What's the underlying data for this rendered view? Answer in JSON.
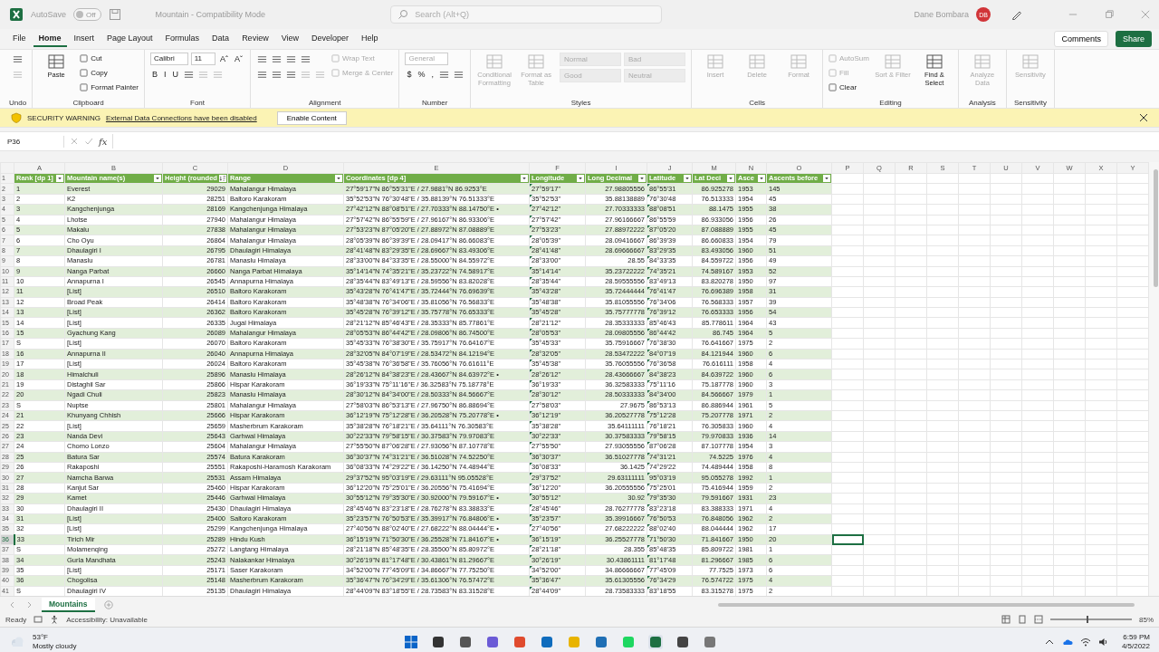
{
  "title_bar": {
    "autosave_label": "AutoSave",
    "autosave_state": "Off",
    "autosave_on": false,
    "document_title": "Mountain - Compatibility Mode",
    "search_placeholder": "Search (Alt+Q)",
    "user_name": "Dane Bombara",
    "user_initials": "DB"
  },
  "menu_tabs": [
    {
      "label": "File",
      "selected": false
    },
    {
      "label": "Home",
      "selected": true
    },
    {
      "label": "Insert",
      "selected": false
    },
    {
      "label": "Page Layout",
      "selected": false
    },
    {
      "label": "Formulas",
      "selected": false
    },
    {
      "label": "Data",
      "selected": false
    },
    {
      "label": "Review",
      "selected": false
    },
    {
      "label": "View",
      "selected": false
    },
    {
      "label": "Developer",
      "selected": false
    },
    {
      "label": "Help",
      "selected": false
    }
  ],
  "actions": {
    "comments": "Comments",
    "share": "Share"
  },
  "ribbon": [
    {
      "label": "Undo",
      "columns": [
        [
          [
            {
              "kind": "icon",
              "disabled": false
            }
          ],
          [
            {
              "kind": "icon",
              "disabled": true
            }
          ]
        ]
      ]
    },
    {
      "label": "Clipboard",
      "columns": [
        [
          [
            {
              "kind": "large",
              "label": "Paste",
              "disabled": false
            }
          ]
        ],
        [
          [
            {
              "kind": "small",
              "label": "Cut",
              "disabled": false
            }
          ],
          [
            {
              "kind": "small",
              "label": "Copy",
              "disabled": false
            }
          ],
          [
            {
              "kind": "small",
              "label": "Format Painter",
              "disabled": false
            }
          ]
        ]
      ]
    },
    {
      "label": "Font",
      "columns": [
        [
          [
            {
              "kind": "field",
              "label": "Calibri",
              "disabled": false
            },
            {
              "kind": "field",
              "label": "11",
              "disabled": false
            },
            {
              "kind": "glyph",
              "label": "Aˆ",
              "disabled": false
            },
            {
              "kind": "glyph",
              "label": "Aˇ",
              "disabled": false
            }
          ],
          [
            {
              "kind": "glyph",
              "label": "B",
              "disabled": false
            },
            {
              "kind": "glyph",
              "label": "I",
              "disabled": false
            },
            {
              "kind": "glyph",
              "label": "U",
              "disabled": false
            },
            {
              "kind": "icon",
              "disabled": false
            },
            {
              "kind": "icon",
              "disabled": true
            },
            {
              "kind": "icon",
              "disabled": true
            }
          ]
        ]
      ]
    },
    {
      "label": "Alignment",
      "columns": [
        [
          [
            {
              "kind": "icon",
              "disabled": false
            },
            {
              "kind": "icon",
              "disabled": false
            },
            {
              "kind": "icon",
              "disabled": false
            },
            {
              "kind": "icon",
              "disabled": false
            }
          ],
          [
            {
              "kind": "icon",
              "disabled": false
            },
            {
              "kind": "icon",
              "disabled": false
            },
            {
              "kind": "icon",
              "disabled": false
            },
            {
              "kind": "icon",
              "disabled": true
            },
            {
              "kind": "icon",
              "disabled": true
            }
          ]
        ],
        [
          [
            {
              "kind": "small",
              "label": "Wrap Text",
              "disabled": true
            }
          ],
          [
            {
              "kind": "small",
              "label": "Merge & Center",
              "disabled": true
            }
          ]
        ]
      ]
    },
    {
      "label": "Number",
      "columns": [
        [
          [
            {
              "kind": "field",
              "label": "General",
              "disabled": true
            }
          ],
          [
            {
              "kind": "glyph",
              "label": "$",
              "disabled": false
            },
            {
              "kind": "glyph",
              "label": "%",
              "disabled": false
            },
            {
              "kind": "glyph",
              "label": ",",
              "disabled": false
            },
            {
              "kind": "icon",
              "disabled": false
            },
            {
              "kind": "icon",
              "disabled": false
            }
          ]
        ]
      ]
    },
    {
      "label": "Styles",
      "columns": [
        [
          [
            {
              "kind": "large",
              "label": "Conditional Formatting",
              "disabled": true
            }
          ]
        ],
        [
          [
            {
              "kind": "large",
              "label": "Format as Table",
              "disabled": true
            }
          ]
        ],
        [
          [
            {
              "kind": "style",
              "label": "Normal",
              "disabled": true
            },
            {
              "kind": "style",
              "label": "Bad",
              "disabled": true
            }
          ],
          [
            {
              "kind": "style",
              "label": "Good",
              "disabled": true
            },
            {
              "kind": "style",
              "label": "Neutral",
              "disabled": true
            }
          ]
        ]
      ]
    },
    {
      "label": "Cells",
      "columns": [
        [
          [
            {
              "kind": "large",
              "label": "Insert",
              "disabled": true
            }
          ]
        ],
        [
          [
            {
              "kind": "large",
              "label": "Delete",
              "disabled": true
            }
          ]
        ],
        [
          [
            {
              "kind": "large",
              "label": "Format",
              "disabled": true
            }
          ]
        ]
      ]
    },
    {
      "label": "Editing",
      "columns": [
        [
          [
            {
              "kind": "small",
              "label": "AutoSum",
              "disabled": true
            }
          ],
          [
            {
              "kind": "small",
              "label": "Fill",
              "disabled": true
            }
          ],
          [
            {
              "kind": "small",
              "label": "Clear",
              "disabled": false
            }
          ]
        ],
        [
          [
            {
              "kind": "large",
              "label": "Sort & Filter",
              "disabled": true
            }
          ]
        ],
        [
          [
            {
              "kind": "large",
              "label": "Find & Select",
              "disabled": false
            }
          ]
        ]
      ]
    },
    {
      "label": "Analysis",
      "columns": [
        [
          [
            {
              "kind": "large",
              "label": "Analyze Data",
              "disabled": true
            }
          ]
        ]
      ]
    },
    {
      "label": "Sensitivity",
      "columns": [
        [
          [
            {
              "kind": "large",
              "label": "Sensitivity",
              "disabled": true
            }
          ]
        ]
      ]
    }
  ],
  "security_bar": {
    "title": "SECURITY WARNING",
    "message": "External Data Connections have been disabled",
    "button": "Enable Content"
  },
  "formula_bar": {
    "name_box": "P36",
    "fx_label": "fx"
  },
  "sheet": {
    "columns": [
      {
        "letter": "A",
        "header": "Rank [dp 1]",
        "kind": "text",
        "sorted": false
      },
      {
        "letter": "B",
        "header": "Mountain name(s)",
        "kind": "text",
        "sorted": false
      },
      {
        "letter": "C",
        "header": "Height (rounded",
        "kind": "number",
        "sorted": true
      },
      {
        "letter": "D",
        "header": "Range",
        "kind": "text",
        "sorted": false
      },
      {
        "letter": "E",
        "header": "Coordinates [dp 4]",
        "kind": "text",
        "sorted": false
      },
      {
        "letter": "F",
        "header": "Longitude",
        "kind": "flagged",
        "sorted": false
      },
      {
        "letter": "I",
        "header": "Long Decimal",
        "kind": "number",
        "sorted": false
      },
      {
        "letter": "J",
        "header": "Latitude",
        "kind": "flagged",
        "sorted": false
      },
      {
        "letter": "M",
        "header": "Lat Deci",
        "kind": "number",
        "sorted": false
      },
      {
        "letter": "N",
        "header": "Asce",
        "kind": "text",
        "sorted": false
      },
      {
        "letter": "O",
        "header": "Ascents before",
        "kind": "text",
        "sorted": false
      }
    ],
    "header_row": "1",
    "empty_columns": [
      "P",
      "Q",
      "R",
      "S",
      "T",
      "U",
      "V",
      "W",
      "X",
      "Y"
    ],
    "rows": [
      {
        "n": "2",
        "selected": false,
        "cells": [
          "1",
          "Everest",
          "29029",
          "Mahalangur Himalaya",
          "27°59'17\"N 86°55'31\"E / 27.9881°N 86.9253°E",
          "27°59'17\"",
          "27.98805556",
          "86°55'31",
          "86.925278",
          "1953",
          "145"
        ]
      },
      {
        "n": "3",
        "selected": false,
        "cells": [
          "2",
          "K2",
          "28251",
          "Baltoro Karakoram",
          "35°52'53\"N 76°30'48\"E / 35.88139°N 76.51333°E",
          "35°52'53\"",
          "35.88138889",
          "76°30'48",
          "76.513333",
          "1954",
          "45"
        ]
      },
      {
        "n": "4",
        "selected": false,
        "cells": [
          "3",
          "Kangchenjunga",
          "28169",
          "Kangchenjunga Himalaya",
          "27°42'12\"N 88°08'51\"E / 27.70333°N 88.14750°E •",
          "27°42'12\"",
          "27.70333333",
          "88°08'51",
          "88.1475",
          "1955",
          "38"
        ]
      },
      {
        "n": "5",
        "selected": false,
        "cells": [
          "4",
          "Lhotse",
          "27940",
          "Mahalangur Himalaya",
          "27°57'42\"N 86°55'59\"E / 27.96167°N 86.93306°E",
          "27°57'42\"",
          "27.96166667",
          "86°55'59",
          "86.933056",
          "1956",
          "26"
        ]
      },
      {
        "n": "6",
        "selected": false,
        "cells": [
          "5",
          "Makalu",
          "27838",
          "Mahalangur Himalaya",
          "27°53'23\"N 87°05'20\"E / 27.88972°N 87.08889°E",
          "27°53'23\"",
          "27.88972222",
          "87°05'20",
          "87.088889",
          "1955",
          "45"
        ]
      },
      {
        "n": "7",
        "selected": false,
        "cells": [
          "6",
          "Cho Oyu",
          "26864",
          "Mahalangur Himalaya",
          "28°05'39\"N 86°39'39\"E / 28.09417°N 86.66083°E",
          "28°05'39\"",
          "28.09416667",
          "86°39'39",
          "86.660833",
          "1954",
          "79"
        ]
      },
      {
        "n": "8",
        "selected": false,
        "cells": [
          "7",
          "Dhaulagiri I",
          "26795",
          "Dhaulagiri Himalaya",
          "28°41'48\"N 83°29'35\"E / 28.69667°N 83.49306°E",
          "28°41'48\"",
          "28.69666667",
          "83°29'35",
          "83.493056",
          "1960",
          "51"
        ]
      },
      {
        "n": "9",
        "selected": false,
        "cells": [
          "8",
          "Manaslu",
          "26781",
          "Manaslu Himalaya",
          "28°33'00\"N 84°33'35\"E / 28.55000°N 84.55972°E",
          "28°33'00\"",
          "28.55",
          "84°33'35",
          "84.559722",
          "1956",
          "49"
        ]
      },
      {
        "n": "10",
        "selected": false,
        "cells": [
          "9",
          "Nanga Parbat",
          "26660",
          "Nanga Parbat Himalaya",
          "35°14'14\"N 74°35'21\"E / 35.23722°N 74.58917°E",
          "35°14'14\"",
          "35.23722222",
          "74°35'21",
          "74.589167",
          "1953",
          "52"
        ]
      },
      {
        "n": "11",
        "selected": false,
        "cells": [
          "10",
          "Annapurna I",
          "26545",
          "Annapurna Himalaya",
          "28°35'44\"N 83°49'13\"E / 28.59556°N 83.82028°E",
          "28°35'44\"",
          "28.59555556",
          "83°49'13",
          "83.820278",
          "1950",
          "97"
        ]
      },
      {
        "n": "12",
        "selected": false,
        "cells": [
          "11",
          "[List]",
          "26510",
          "Baltoro Karakoram",
          "35°43'28\"N 76°41'47\"E / 35.72444°N 76.69639°E",
          "35°43'28\"",
          "35.72444444",
          "76°41'47",
          "76.696389",
          "1958",
          "31"
        ]
      },
      {
        "n": "13",
        "selected": false,
        "cells": [
          "12",
          "Broad Peak",
          "26414",
          "Baltoro Karakoram",
          "35°48'38\"N 76°34'06\"E / 35.81056°N 76.56833°E",
          "35°48'38\"",
          "35.81055556",
          "76°34'06",
          "76.568333",
          "1957",
          "39"
        ]
      },
      {
        "n": "14",
        "selected": false,
        "cells": [
          "13",
          "[List]",
          "26362",
          "Baltoro Karakoram",
          "35°45'28\"N 76°39'12\"E / 35.75778°N 76.65333°E",
          "35°45'28\"",
          "35.75777778",
          "76°39'12",
          "76.653333",
          "1956",
          "54"
        ]
      },
      {
        "n": "15",
        "selected": false,
        "cells": [
          "14",
          "[List]",
          "26335",
          "Jugal Himalaya",
          "28°21'12\"N 85°46'43\"E / 28.35333°N 85.77861°E",
          "28°21'12\"",
          "28.35333333",
          "85°46'43",
          "85.778611",
          "1964",
          "43"
        ]
      },
      {
        "n": "16",
        "selected": false,
        "cells": [
          "15",
          "Gyachung Kang",
          "26089",
          "Mahalangur Himalaya",
          "28°05'53\"N 86°44'42\"E / 28.09806°N 86.74500°E",
          "28°05'53\"",
          "28.09805556",
          "86°44'42",
          "86.745",
          "1964",
          "5"
        ]
      },
      {
        "n": "17",
        "selected": false,
        "cells": [
          "S",
          "[List]",
          "26070",
          "Baltoro Karakoram",
          "35°45'33\"N 76°38'30\"E / 35.75917°N 76.64167°E",
          "35°45'33\"",
          "35.75916667",
          "76°38'30",
          "76.641667",
          "1975",
          "2"
        ]
      },
      {
        "n": "18",
        "selected": false,
        "cells": [
          "16",
          "Annapurna II",
          "26040",
          "Annapurna Himalaya",
          "28°32'05\"N 84°07'19\"E / 28.53472°N 84.12194°E",
          "28°32'05\"",
          "28.53472222",
          "84°07'19",
          "84.121944",
          "1960",
          "6"
        ]
      },
      {
        "n": "19",
        "selected": false,
        "cells": [
          "17",
          "[List]",
          "26024",
          "Baltoro Karakoram",
          "35°45'38\"N 76°36'58\"E / 35.76056°N 76.61611°E",
          "35°45'38\"",
          "35.76055556",
          "76°36'58",
          "76.616111",
          "1958",
          "4"
        ]
      },
      {
        "n": "20",
        "selected": false,
        "cells": [
          "18",
          "Himalchuli",
          "25896",
          "Manaslu Himalaya",
          "28°26'12\"N 84°38'23\"E / 28.43667°N 84.63972°E •",
          "28°26'12\"",
          "28.43666667",
          "84°38'23",
          "84.639722",
          "1960",
          "6"
        ]
      },
      {
        "n": "21",
        "selected": false,
        "cells": [
          "19",
          "Distaghil Sar",
          "25866",
          "Hispar Karakoram",
          "36°19'33\"N 75°11'16\"E / 36.32583°N 75.18778°E",
          "36°19'33\"",
          "36.32583333",
          "75°11'16",
          "75.187778",
          "1960",
          "3"
        ]
      },
      {
        "n": "22",
        "selected": false,
        "cells": [
          "20",
          "Ngadi Chuli",
          "25823",
          "Manaslu Himalaya",
          "28°30'12\"N 84°34'00\"E / 28.50333°N 84.56667°E",
          "28°30'12\"",
          "28.50333333",
          "84°34'00",
          "84.566667",
          "1979",
          "1"
        ]
      },
      {
        "n": "23",
        "selected": false,
        "cells": [
          "S",
          "Nuptse",
          "25801",
          "Mahalangur Himalaya",
          "27°58'03\"N 86°53'13\"E / 27.96750°N 86.88694°E",
          "27°58'03\"",
          "27.9675",
          "86°53'13",
          "86.886944",
          "1961",
          "5"
        ]
      },
      {
        "n": "24",
        "selected": false,
        "cells": [
          "21",
          "Khunyang Chhish",
          "25666",
          "Hispar Karakoram",
          "36°12'19\"N 75°12'28\"E / 36.20528°N 75.20778°E •",
          "36°12'19\"",
          "36.20527778",
          "75°12'28",
          "75.207778",
          "1971",
          "2"
        ]
      },
      {
        "n": "25",
        "selected": false,
        "cells": [
          "22",
          "[List]",
          "25659",
          "Masherbrum Karakoram",
          "35°38'28\"N 76°18'21\"E / 35.64111°N 76.30583°E",
          "35°38'28\"",
          "35.64111111",
          "76°18'21",
          "76.305833",
          "1960",
          "4"
        ]
      },
      {
        "n": "26",
        "selected": false,
        "cells": [
          "23",
          "Nanda Devi",
          "25643",
          "Garhwal Himalaya",
          "30°22'33\"N 79°58'15\"E / 30.37583°N 79.97083°E",
          "30°22'33\"",
          "30.37583333",
          "79°58'15",
          "79.970833",
          "1936",
          "14"
        ]
      },
      {
        "n": "27",
        "selected": false,
        "cells": [
          "24",
          "Chomo Lonzo",
          "25604",
          "Mahalangur Himalaya",
          "27°55'50\"N 87°06'28\"E / 27.93056°N 87.10778°E",
          "27°55'50\"",
          "27.93055556",
          "87°06'28",
          "87.107778",
          "1954",
          "3"
        ]
      },
      {
        "n": "28",
        "selected": false,
        "cells": [
          "25",
          "Batura Sar",
          "25574",
          "Batura Karakoram",
          "36°30'37\"N 74°31'21\"E / 36.51028°N 74.52250°E",
          "36°30'37\"",
          "36.51027778",
          "74°31'21",
          "74.5225",
          "1976",
          "4"
        ]
      },
      {
        "n": "29",
        "selected": false,
        "cells": [
          "26",
          "Rakaposhi",
          "25551",
          "Rakaposhi-Haramosh Karakoram",
          "36°08'33\"N 74°29'22\"E / 36.14250°N 74.48944°E",
          "36°08'33\"",
          "36.1425",
          "74°29'22",
          "74.489444",
          "1958",
          "8"
        ]
      },
      {
        "n": "30",
        "selected": false,
        "cells": [
          "27",
          "Namcha Barwa",
          "25531",
          "Assam Himalaya",
          "29°37'52\"N 95°03'19\"E / 29.63111°N 95.05528°E",
          "29°37'52\"",
          "29.63111111",
          "95°03'19",
          "95.055278",
          "1992",
          "1"
        ]
      },
      {
        "n": "31",
        "selected": false,
        "cells": [
          "28",
          "Kanjut Sar",
          "25460",
          "Hispar Karakoram",
          "36°12'20\"N 75°25'01\"E / 36.20556°N 75.41694°E",
          "36°12'20\"",
          "36.20555556",
          "75°25'01",
          "75.416944",
          "1959",
          "2"
        ]
      },
      {
        "n": "32",
        "selected": false,
        "cells": [
          "29",
          "Kamet",
          "25446",
          "Garhwal Himalaya",
          "30°55'12\"N 79°35'30\"E / 30.92000°N 79.59167°E •",
          "30°55'12\"",
          "30.92",
          "79°35'30",
          "79.591667",
          "1931",
          "23"
        ]
      },
      {
        "n": "33",
        "selected": false,
        "cells": [
          "30",
          "Dhaulagiri II",
          "25430",
          "Dhaulagiri Himalaya",
          "28°45'46\"N 83°23'18\"E / 28.76278°N 83.38833°E",
          "28°45'46\"",
          "28.76277778",
          "83°23'18",
          "83.388333",
          "1971",
          "4"
        ]
      },
      {
        "n": "34",
        "selected": false,
        "cells": [
          "31",
          "[List]",
          "25400",
          "Saltoro Karakoram",
          "35°23'57\"N 76°50'53\"E / 35.39917°N 76.84806°E •",
          "35°23'57\"",
          "35.39916667",
          "76°50'53",
          "76.848056",
          "1962",
          "2"
        ]
      },
      {
        "n": "35",
        "selected": false,
        "cells": [
          "32",
          "[List]",
          "25299",
          "Kangchenjunga Himalaya",
          "27°40'56\"N 88°02'40\"E / 27.68222°N 88.04444°E •",
          "27°40'56\"",
          "27.68222222",
          "88°02'40",
          "88.044444",
          "1962",
          "17"
        ]
      },
      {
        "n": "36",
        "selected": true,
        "cells": [
          "33",
          "Tirich Mir",
          "25289",
          "Hindu Kush",
          "36°15'19\"N 71°50'30\"E / 36.25528°N 71.84167°E •",
          "36°15'19\"",
          "36.25527778",
          "71°50'30",
          "71.841667",
          "1950",
          "20"
        ]
      },
      {
        "n": "37",
        "selected": false,
        "cells": [
          "S",
          "Molamenqing",
          "25272",
          "Langtang Himalaya",
          "28°21'18\"N 85°48'35\"E / 28.35500°N 85.80972°E",
          "28°21'18\"",
          "28.355",
          "85°48'35",
          "85.809722",
          "1981",
          "1"
        ]
      },
      {
        "n": "38",
        "selected": false,
        "cells": [
          "34",
          "Gurla Mandhata",
          "25243",
          "Nalakankar Himalaya",
          "30°26'19\"N 81°17'48\"E / 30.43861°N 81.29667°E",
          "30°26'19\"",
          "30.43861111",
          "81°17'48",
          "81.296667",
          "1985",
          "6"
        ]
      },
      {
        "n": "39",
        "selected": false,
        "cells": [
          "35",
          "[List]",
          "25171",
          "Saser Karakoram",
          "34°52'00\"N 77°45'09\"E / 34.86667°N 77.75250°E",
          "34°52'00\"",
          "34.86666667",
          "77°45'09",
          "77.7525",
          "1973",
          "6"
        ]
      },
      {
        "n": "40",
        "selected": false,
        "cells": [
          "36",
          "Chogolisa",
          "25148",
          "Masherbrum Karakoram",
          "35°36'47\"N 76°34'29\"E / 35.61306°N 76.57472°E",
          "35°36'47\"",
          "35.61305556",
          "76°34'29",
          "76.574722",
          "1975",
          "4"
        ]
      },
      {
        "n": "41",
        "selected": false,
        "cells": [
          "S",
          "Dhaulagiri IV",
          "25135",
          "Dhaulagiri Himalaya",
          "28°44'09\"N 83°18'55\"E / 28.73583°N 83.31528°E",
          "28°44'09\"",
          "28.73583333",
          "83°18'55",
          "83.315278",
          "1975",
          "2"
        ]
      }
    ]
  },
  "sheet_tabs": [
    {
      "label": "Mountains",
      "selected": true
    }
  ],
  "status_bar": {
    "ready": "Ready",
    "accessibility": "Accessibility: Unavailable",
    "zoom_slider": {
      "level": 0.45
    },
    "zoom": "85%"
  },
  "taskbar": {
    "temperature": "53°F",
    "weather": "Mostly cloudy",
    "apps": [
      {
        "active": false
      },
      {
        "active": false
      },
      {
        "active": false
      },
      {
        "active": false
      },
      {
        "active": false
      },
      {
        "active": false
      },
      {
        "active": false
      },
      {
        "active": false
      },
      {
        "active": false
      },
      {
        "active": true
      },
      {
        "active": false
      },
      {
        "active": false
      }
    ],
    "time": "6:59 PM",
    "date": "4/5/2022"
  }
}
